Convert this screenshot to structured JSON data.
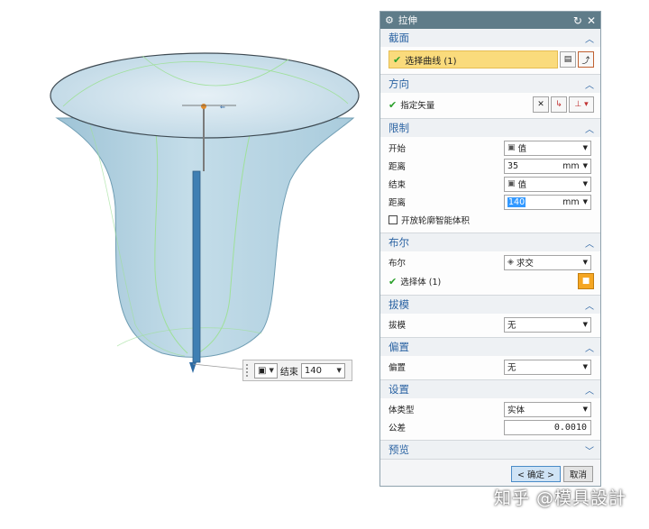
{
  "dialog": {
    "title": "拉伸",
    "colors": {
      "titlebar": "#5f7c89",
      "group_title": "#2c64a3",
      "highlight": "#fadb7c"
    },
    "section": {
      "title": "截面",
      "select_curve": "选择曲线 (1)"
    },
    "direction": {
      "title": "方向",
      "specify_vector": "指定矢量"
    },
    "limits": {
      "title": "限制",
      "start_label": "开始",
      "start_value": "值",
      "distance1_label": "距离",
      "distance1_value": "35",
      "distance1_unit": "mm",
      "end_label": "结束",
      "end_value": "值",
      "distance2_label": "距离",
      "distance2_value": "140",
      "distance2_unit": "mm",
      "open_profile": "开放轮廓智能体积"
    },
    "boolean": {
      "title": "布尔",
      "boolean_label": "布尔",
      "boolean_value": "求交",
      "select_body": "选择体 (1)"
    },
    "draft": {
      "title": "拔模",
      "draft_label": "拔模",
      "draft_value": "无"
    },
    "offset": {
      "title": "偏置",
      "offset_label": "偏置",
      "offset_value": "无"
    },
    "settings": {
      "title": "设置",
      "body_type_label": "体类型",
      "body_type_value": "实体",
      "tolerance_label": "公差",
      "tolerance_value": "0.0010"
    },
    "preview": {
      "title": "预览"
    },
    "ok_label": "< 确定 >",
    "cancel_label": "取消"
  },
  "onscreen_input": {
    "label": "结束",
    "value": "140"
  },
  "watermark": "知乎 @模具設計"
}
